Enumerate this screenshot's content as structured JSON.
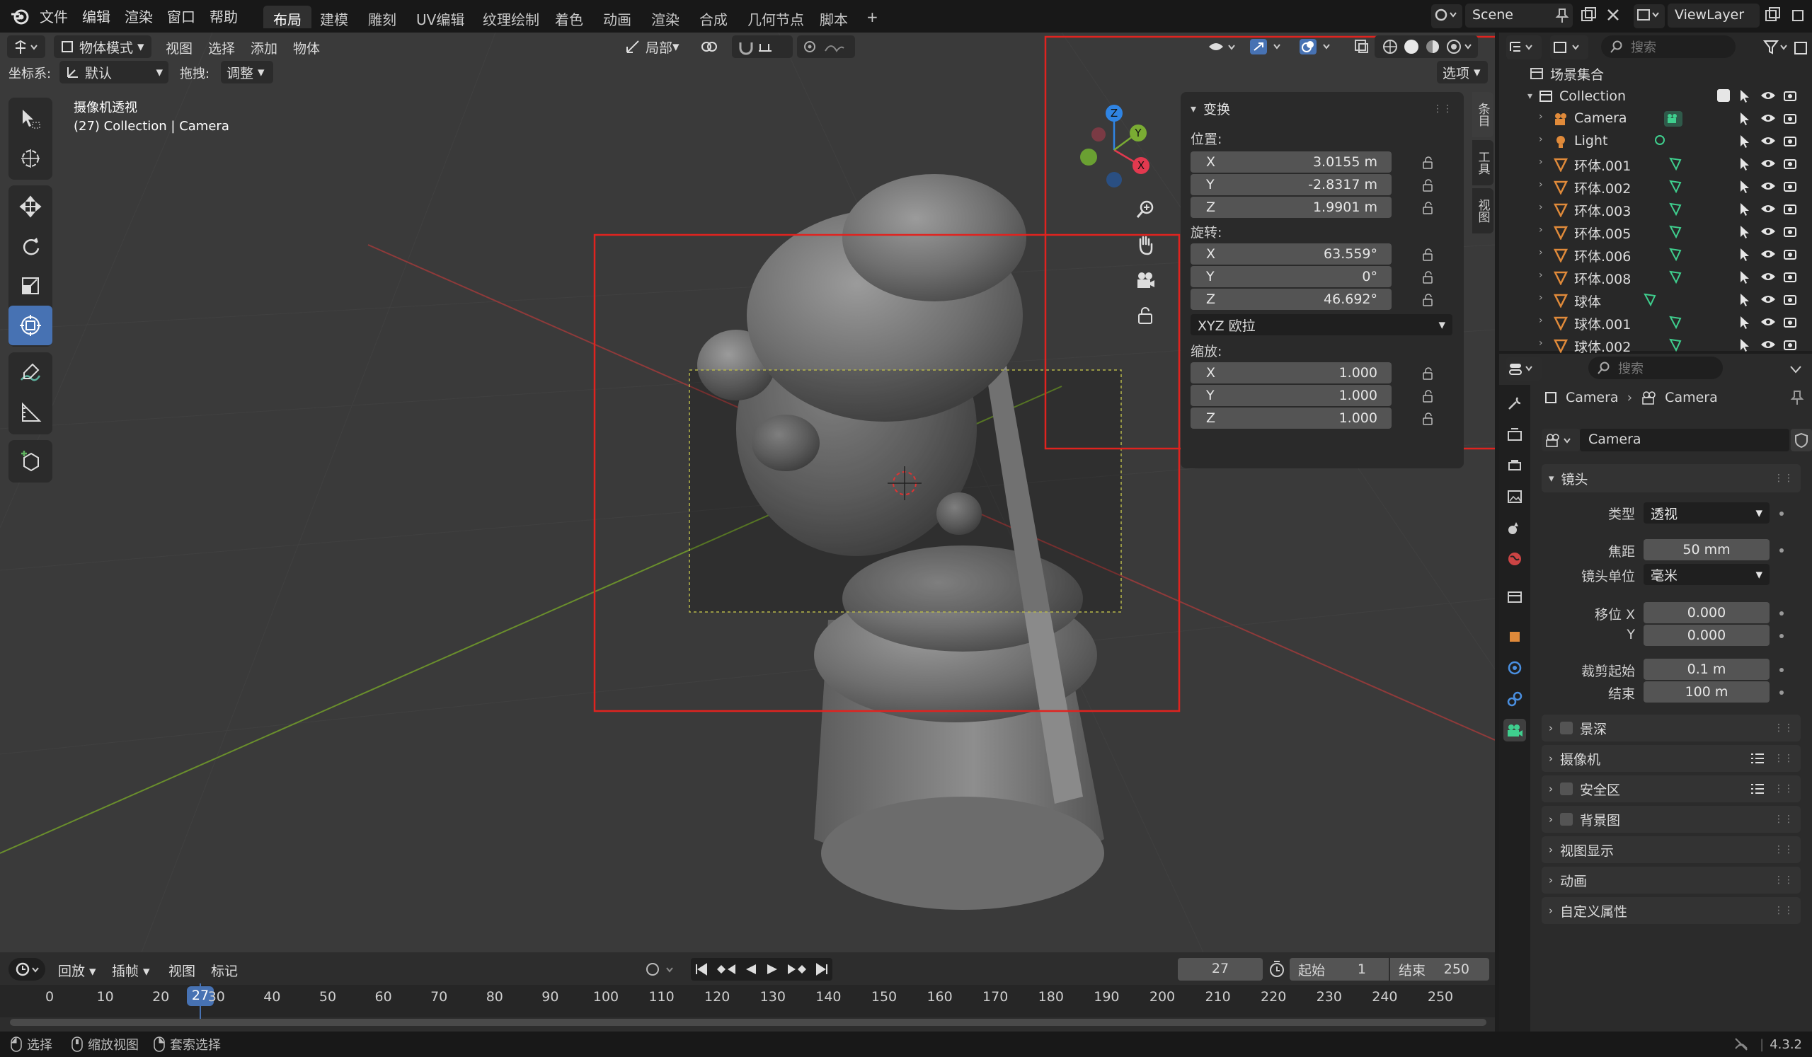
{
  "menu": [
    "文件",
    "编辑",
    "渲染",
    "窗口",
    "帮助"
  ],
  "workspaces": [
    "布局",
    "建模",
    "雕刻",
    "UV编辑",
    "纹理绘制",
    "着色",
    "动画",
    "渲染",
    "合成",
    "几何节点",
    "脚本"
  ],
  "active_workspace": "布局",
  "add_tab": "+",
  "scene_name": "Scene",
  "view_layer": "ViewLayer",
  "viewport": {
    "mode": "物体模式",
    "menus": [
      "视图",
      "选择",
      "添加",
      "物体"
    ],
    "transform_orientation_label": "坐标系:",
    "transform_orientation": "默认",
    "drag_label": "拖拽:",
    "drag_value": "调整",
    "pivot": "局部",
    "options_label": "选项",
    "overlay_title": "摄像机透视",
    "overlay_subtitle": "(27) Collection | Camera",
    "gizmo_labels": {
      "x": "X",
      "y": "Y",
      "z": "Z"
    }
  },
  "npanel": {
    "header": "变换",
    "location_label": "位置:",
    "location": [
      {
        "axis": "X",
        "value": "3.0155 m"
      },
      {
        "axis": "Y",
        "value": "-2.8317 m"
      },
      {
        "axis": "Z",
        "value": "1.9901 m"
      }
    ],
    "rotation_label": "旋转:",
    "rotation": [
      {
        "axis": "X",
        "value": "63.559°"
      },
      {
        "axis": "Y",
        "value": "0°"
      },
      {
        "axis": "Z",
        "value": "46.692°"
      }
    ],
    "rotation_mode": "XYZ 欧拉",
    "scale_label": "缩放:",
    "scale": [
      {
        "axis": "X",
        "value": "1.000"
      },
      {
        "axis": "Y",
        "value": "1.000"
      },
      {
        "axis": "Z",
        "value": "1.000"
      }
    ],
    "side_tabs": [
      "条目",
      "工具",
      "视图"
    ]
  },
  "outliner": {
    "search_placeholder": "搜索",
    "root": "场景集合",
    "collection": "Collection",
    "items": [
      "Camera",
      "Light",
      "环体.001",
      "环体.002",
      "环体.003",
      "环体.005",
      "环体.006",
      "环体.008",
      "球体",
      "球体.001",
      "球体.002"
    ]
  },
  "properties": {
    "search_placeholder": "搜索",
    "breadcrumb": [
      "Camera",
      "Camera"
    ],
    "data_name": "Camera",
    "lens_header": "镜头",
    "type_label": "类型",
    "type_value": "透视",
    "focal_label": "焦距",
    "focal_value": "50 mm",
    "lens_unit_label": "镜头单位",
    "lens_unit_value": "毫米",
    "shift_x_label": "移位 X",
    "shift_x_value": "0.000",
    "shift_y_label": "Y",
    "shift_y_value": "0.000",
    "clip_start_label": "裁剪起始",
    "clip_start_value": "0.1 m",
    "clip_end_label": "结束",
    "clip_end_value": "100 m",
    "panels": [
      "景深",
      "摄像机",
      "安全区",
      "背景图",
      "视图显示",
      "动画",
      "自定义属性"
    ]
  },
  "timeline": {
    "menus": [
      "回放",
      "插帧",
      "视图",
      "标记"
    ],
    "current_frame": "27",
    "start_label": "起始",
    "start": "1",
    "end_label": "结束",
    "end": "250",
    "ticks": [
      "0",
      "10",
      "20",
      "30",
      "40",
      "50",
      "60",
      "70",
      "80",
      "90",
      "100",
      "110",
      "120",
      "130",
      "140",
      "150",
      "160",
      "170",
      "180",
      "190",
      "200",
      "210",
      "220",
      "230",
      "240",
      "250"
    ],
    "marker_label": "27"
  },
  "status": {
    "select": "选择",
    "zoom": "缩放视图",
    "lasso": "套索选择",
    "version": "4.3.2"
  },
  "colors": {
    "accent": "#4772b3",
    "axis_x": "#e2394f",
    "axis_y": "#7aac33",
    "axis_z": "#2f84e3",
    "highlight_box": "#e0231f"
  }
}
